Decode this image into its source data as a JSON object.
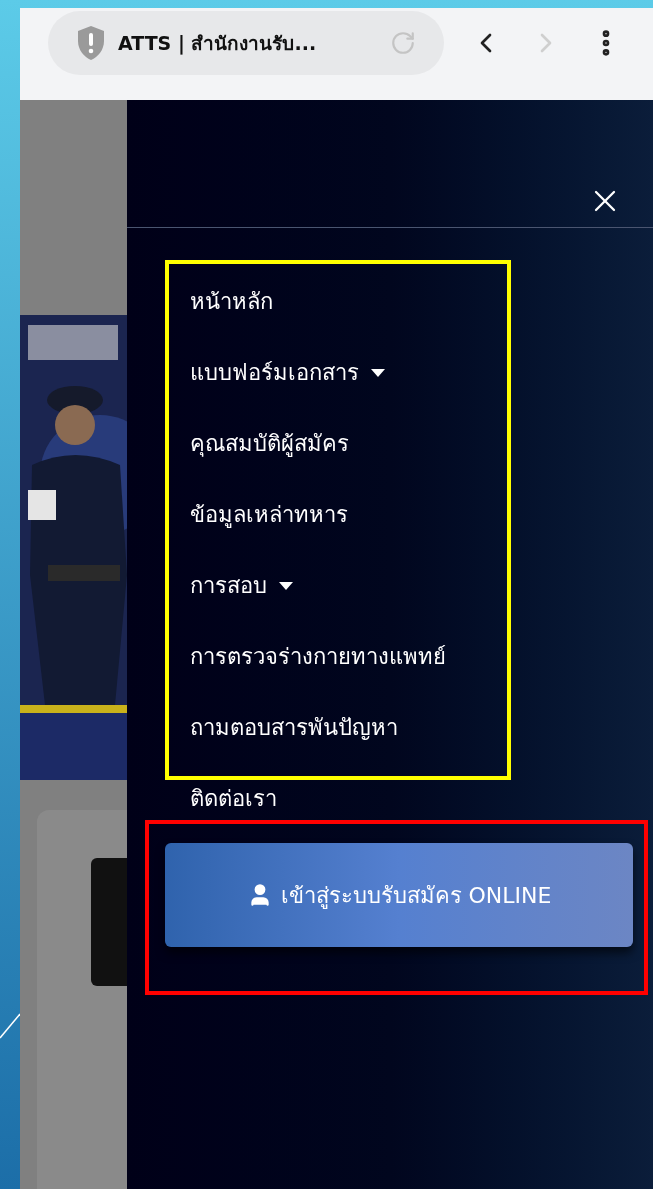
{
  "browser": {
    "tab_title": "ATTS | สำนักงานรับ...",
    "back_disabled": false,
    "forward_disabled": true
  },
  "menu": {
    "items": [
      {
        "label": "หน้าหลัก",
        "has_dropdown": false,
        "boxed": true
      },
      {
        "label": "แบบฟอร์มเอกสาร",
        "has_dropdown": true,
        "boxed": true
      },
      {
        "label": "คุณสมบัติผู้สมัคร",
        "has_dropdown": false,
        "boxed": true
      },
      {
        "label": "ข้อมูลเหล่าทหาร",
        "has_dropdown": false,
        "boxed": true
      },
      {
        "label": "การสอบ",
        "has_dropdown": true,
        "boxed": true
      },
      {
        "label": "การตรวจร่างกายทางแพทย์",
        "has_dropdown": false,
        "boxed": true
      },
      {
        "label": "ถามตอบสารพันปัญหา",
        "has_dropdown": false,
        "boxed": true
      },
      {
        "label": "ติดต่อเรา",
        "has_dropdown": false,
        "boxed": false
      }
    ]
  },
  "login_button": {
    "label": "เข้าสู่ระบบรับสมัคร ONLINE"
  }
}
